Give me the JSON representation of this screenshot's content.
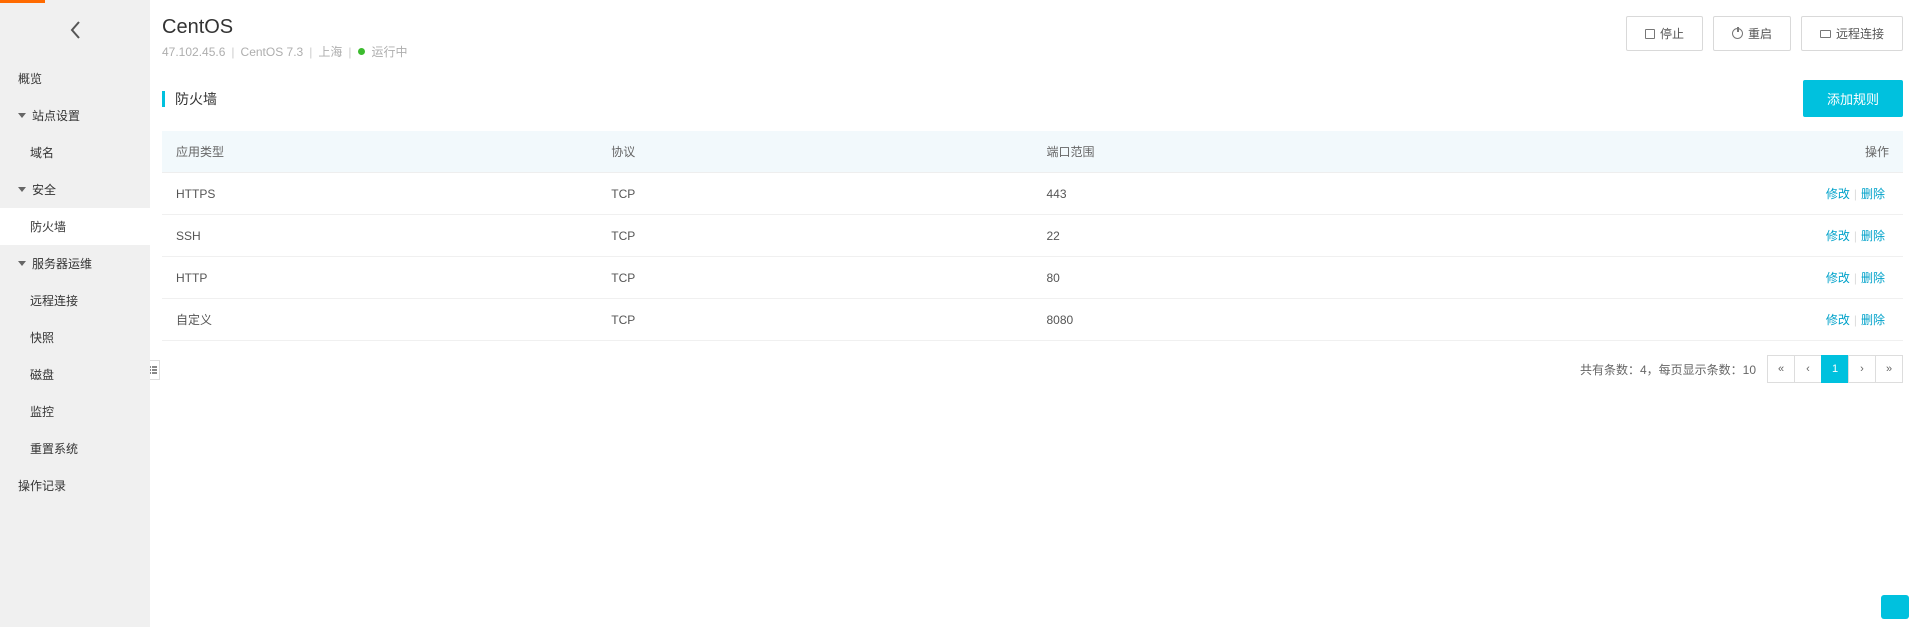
{
  "header": {
    "title": "CentOS",
    "ip": "47.102.45.6",
    "os": "CentOS 7.3",
    "region": "上海",
    "status": "运行中"
  },
  "actions": {
    "stop": "停止",
    "reboot": "重启",
    "remote": "远程连接"
  },
  "sidebar": {
    "overview": "概览",
    "site_settings": "站点设置",
    "domain": "域名",
    "security": "安全",
    "firewall": "防火墙",
    "server_ops": "服务器运维",
    "remote_connect": "远程连接",
    "snapshot": "快照",
    "disk": "磁盘",
    "monitor": "监控",
    "reset_system": "重置系统",
    "operation_log": "操作记录"
  },
  "panel": {
    "section_title": "防火墙",
    "add_rule": "添加规则",
    "columns": {
      "app_type": "应用类型",
      "protocol": "协议",
      "port_range": "端口范围",
      "action": "操作"
    },
    "rows": [
      {
        "app": "HTTPS",
        "proto": "TCP",
        "port": "443"
      },
      {
        "app": "SSH",
        "proto": "TCP",
        "port": "22"
      },
      {
        "app": "HTTP",
        "proto": "TCP",
        "port": "80"
      },
      {
        "app": "自定义",
        "proto": "TCP",
        "port": "8080"
      }
    ],
    "row_actions": {
      "edit": "修改",
      "delete": "删除"
    },
    "pagination": {
      "summary": "共有条数：4，每页显示条数：10",
      "first": "«",
      "prev": "‹",
      "page": "1",
      "next": "›",
      "last": "»"
    }
  }
}
